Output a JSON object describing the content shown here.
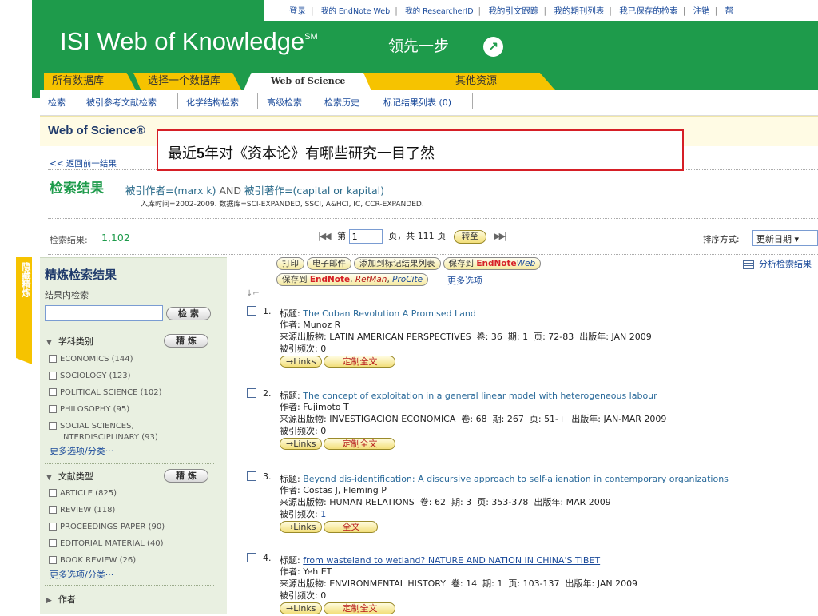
{
  "toplinks": [
    "登录",
    "我的 EndNote Web",
    "我的 ResearcherID",
    "我的引文跟踪",
    "我的期刊列表",
    "我已保存的检索",
    "注销",
    "帮"
  ],
  "logo": {
    "text": "ISI Web of Knowledge",
    "sup": "SM"
  },
  "slogan": "领先一步",
  "tabs": [
    "所有数据库",
    "选择一个数据库",
    "Web of Science",
    "其他资源"
  ],
  "subnav": [
    "检索",
    "被引参考文献检索",
    "化学结构检索",
    "高级检索",
    "检索历史",
    "标记结果列表 (0)"
  ],
  "wos_title": "Web of Science®",
  "annotation": {
    "before": "最近",
    "bold": "5",
    "after": "年对《资本论》有哪些研究一目了然"
  },
  "back_link": "<< 返回前一结果",
  "results_heading": "检索结果",
  "query": {
    "p1": "被引作者=(marx k)",
    "op": " AND ",
    "p2": "被引著作=(capital or kapital)"
  },
  "timespan": "入库时间=2002-2009. 数据库=SCI-EXPANDED, SSCI, A&HCI, IC, CCR-EXPANDED.",
  "results_label": "检索结果:",
  "results_count": "1,102",
  "pager": {
    "first": "|◀◀",
    "page_prefix": "第",
    "page_value": "1",
    "page_suffix": "页，共 111 页",
    "go": "转至",
    "next": "▶▶|"
  },
  "sort": {
    "label": "排序方式:",
    "value": "更新日期"
  },
  "hide_tab": "隐藏精炼",
  "refine": {
    "title": "精炼检索结果",
    "within_label": "结果内检索",
    "search_button": "检 索",
    "refine_button": "精 炼",
    "subject": {
      "heading": "学科类别",
      "items": [
        "ECONOMICS (144)",
        "SOCIOLOGY (123)",
        "POLITICAL SCIENCE (102)",
        "PHILOSOPHY (95)",
        "SOCIAL SCIENCES,",
        "INTERDISCIPLINARY (93)"
      ],
      "more": "更多选项/分类···"
    },
    "doctype": {
      "heading": "文献类型",
      "items": [
        "ARTICLE (825)",
        "REVIEW (118)",
        "PROCEEDINGS PAPER (90)",
        "EDITORIAL MATERIAL (40)",
        "BOOK REVIEW (26)"
      ],
      "more": "更多选项/分类···"
    },
    "author_heading": "作者"
  },
  "actions": {
    "print": "打印",
    "email": "电子邮件",
    "add_marked": "添加到标记结果列表",
    "save_to": "保存到",
    "endnote": "EndNote",
    "web": "Web",
    "save_to2": "保存到",
    "endnote2": "EndNote",
    "refman": "RefMan",
    "procite": "ProCite",
    "more_options": "更多选项",
    "analyze": "分析检索结果"
  },
  "labels": {
    "title": "标题:",
    "author": "作者:",
    "source": "来源出版物:",
    "volume": "卷:",
    "issue": "期:",
    "pages": "页:",
    "pubdate": "出版年:",
    "cited": "被引频次:"
  },
  "results": [
    {
      "num": "1.",
      "title": "The Cuban Revolution A Promised Land",
      "author": "Munoz R",
      "source": "LATIN AMERICAN PERSPECTIVES",
      "volume": "36",
      "issue": "1",
      "pages": "72-83",
      "pubdate": "JAN 2009",
      "cited": "0",
      "links": "Links",
      "fulltext": "定制全文"
    },
    {
      "num": "2.",
      "title": "The concept of exploitation in a general linear model with heterogeneous labour",
      "author": "Fujimoto T",
      "source": "INVESTIGACION ECONOMICA",
      "volume": "68",
      "issue": "267",
      "pages": "51-+",
      "pubdate": "JAN-MAR 2009",
      "cited": "0",
      "links": "Links",
      "fulltext": "定制全文"
    },
    {
      "num": "3.",
      "title": "Beyond dis-identification: A discursive approach to self-alienation in contemporary organizations",
      "author": "Costas J, Fleming P",
      "source": "HUMAN RELATIONS",
      "volume": "62",
      "issue": "3",
      "pages": "353-378",
      "pubdate": "MAR 2009",
      "cited": "1",
      "links": "Links",
      "fulltext": "全文"
    },
    {
      "num": "4.",
      "title": "from wasteland to wetland? NATURE AND NATION IN CHINA'S TIBET",
      "author": "Yeh ET",
      "source": "ENVIRONMENTAL HISTORY",
      "volume": "14",
      "issue": "1",
      "pages": "103-137",
      "pubdate": "JAN 2009",
      "cited": "0",
      "links": "Links",
      "fulltext": "定制全文"
    }
  ],
  "colors": {
    "brand_green": "#1e9b4b",
    "tab_yellow": "#f6c300",
    "sidebar": "#e9f0e1",
    "annotation_border": "#d61f26"
  }
}
